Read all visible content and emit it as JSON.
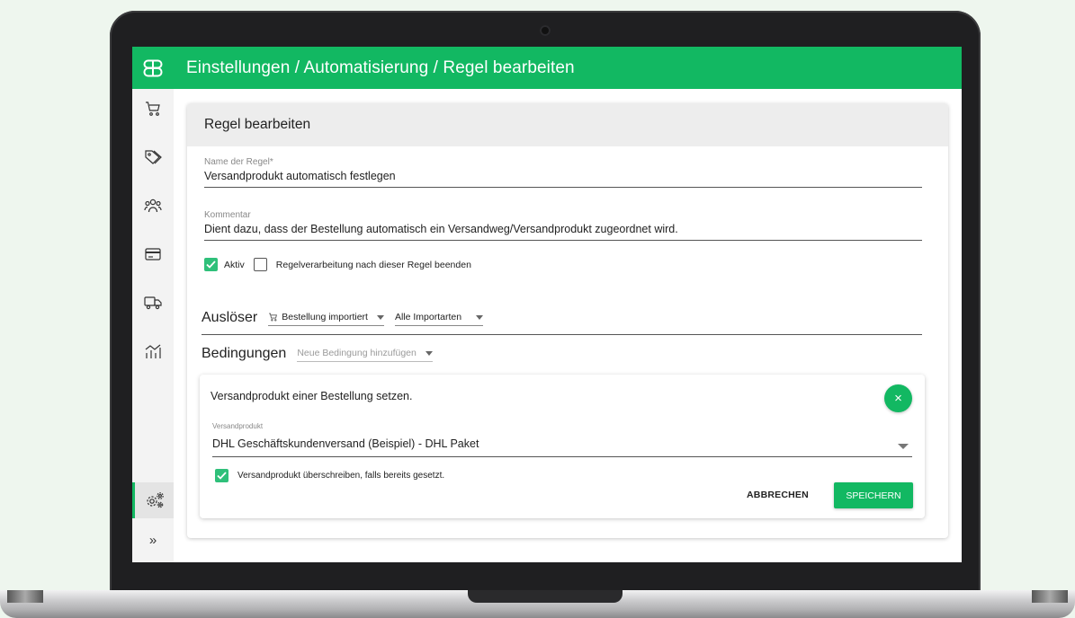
{
  "app": {
    "breadcrumb": "Einstellungen / Automatisierung / Regel bearbeiten",
    "brand_color": "#12b862"
  },
  "sidebar": {
    "items": [
      {
        "icon": "cart-icon"
      },
      {
        "icon": "tags-icon"
      },
      {
        "icon": "users-icon"
      },
      {
        "icon": "credit-card-icon"
      },
      {
        "icon": "truck-icon"
      },
      {
        "icon": "analytics-icon"
      }
    ],
    "settings_icon": "settings-gears-icon",
    "expand_label": "»"
  },
  "form": {
    "header": "Regel bearbeiten",
    "name_label": "Name der Regel*",
    "name_value": "Versandprodukt automatisch festlegen",
    "comment_label": "Kommentar",
    "comment_value": "Dient dazu, dass der Bestellung automatisch ein Versandweg/Versandprodukt zugeordnet wird.",
    "active_label": "Aktiv",
    "active_checked": true,
    "stop_label": "Regelverarbeitung nach dieser Regel beenden",
    "stop_checked": false
  },
  "trigger": {
    "title": "Auslöser",
    "event": "Bestellung importiert",
    "import_type": "Alle Importarten"
  },
  "conditions": {
    "title": "Bedingungen",
    "add_placeholder": "Neue Bedingung hinzufügen"
  },
  "action": {
    "title": "Versandprodukt einer Bestellung setzen.",
    "close_symbol": "×",
    "product_label": "Versandprodukt",
    "product_value": "DHL Geschäftskundenversand (Beispiel) - DHL Paket",
    "overwrite_label": "Versandprodukt überschreiben, falls bereits gesetzt.",
    "overwrite_checked": true,
    "cancel_label": "ABBRECHEN",
    "save_label": "SPEICHERN"
  }
}
